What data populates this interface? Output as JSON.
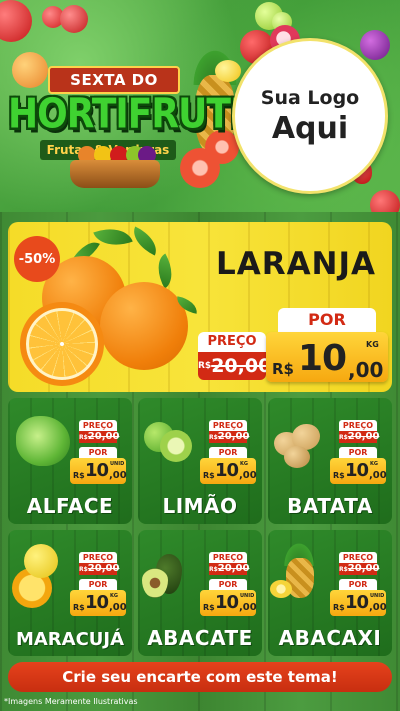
{
  "header": {
    "title_top": "SEXTA DO",
    "title_main": "HORTIFRUTI",
    "title_sub": "Frutas & Verduras",
    "logo_line1": "Sua Logo",
    "logo_line2": "Aqui"
  },
  "featured": {
    "discount": "-50%",
    "name": "LARANJA",
    "preco_label": "PREÇO",
    "por_label": "POR",
    "old_currency": "R$",
    "old_price": "20,00",
    "new_currency": "R$",
    "new_int": "10",
    "new_dec": ",00",
    "unit": "KG"
  },
  "products": [
    {
      "name": "ALFACE",
      "preco_label": "PREÇO",
      "old_currency": "R$",
      "old_price": "20,00",
      "por_label": "POR",
      "currency": "R$",
      "int": "10",
      "dec": ",00",
      "unit": "UNID"
    },
    {
      "name": "LIMÃO",
      "preco_label": "PREÇO",
      "old_currency": "R$",
      "old_price": "20,00",
      "por_label": "POR",
      "currency": "R$",
      "int": "10",
      "dec": ",00",
      "unit": "KG"
    },
    {
      "name": "BATATA",
      "preco_label": "PREÇO",
      "old_currency": "R$",
      "old_price": "20,00",
      "por_label": "POR",
      "currency": "R$",
      "int": "10",
      "dec": ",00",
      "unit": "KG"
    },
    {
      "name": "MARACUJÁ",
      "preco_label": "PREÇO",
      "old_currency": "R$",
      "old_price": "20,00",
      "por_label": "POR",
      "currency": "R$",
      "int": "10",
      "dec": ",00",
      "unit": "KG"
    },
    {
      "name": "ABACATE",
      "preco_label": "PREÇO",
      "old_currency": "R$",
      "old_price": "20,00",
      "por_label": "POR",
      "currency": "R$",
      "int": "10",
      "dec": ",00",
      "unit": "UNID"
    },
    {
      "name": "ABACAXI",
      "preco_label": "PREÇO",
      "old_currency": "R$",
      "old_price": "20,00",
      "por_label": "POR",
      "currency": "R$",
      "int": "10",
      "dec": ",00",
      "unit": "UNID"
    }
  ],
  "footer": {
    "cta": "Crie seu encarte com este tema!",
    "disclaimer": "*Imagens Meramente Ilustrativas"
  },
  "colors": {
    "price_red": "#d22a14",
    "price_yellow": "#ffd53a",
    "card_green": "#2f8a2a",
    "featured_yellow": "#f5dc28"
  }
}
